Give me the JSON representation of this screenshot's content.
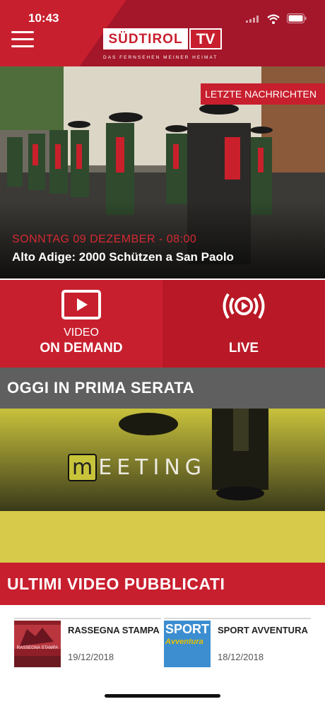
{
  "status_bar": {
    "time": "10:43"
  },
  "header": {
    "logo_main": "SÜDTIROL",
    "logo_tv": "TV",
    "tagline": "DAS FERNSEHEN MEINER HEIMAT"
  },
  "hero": {
    "badge": "LETZTE NACHRICHTEN",
    "date": "SONNTAG 09 DEZEMBER - 08:00",
    "title": "Alto Adige: 2000 Schützen a San Paolo"
  },
  "tiles": {
    "vod": {
      "line1": "VIDEO",
      "line2": "ON DEMAND"
    },
    "live": {
      "line2": "LIVE"
    }
  },
  "prime_time": {
    "heading": "OGGI IN PRIMA SERATA",
    "show_logo_first": "m",
    "show_logo_rest": "EETING"
  },
  "latest": {
    "heading": "ULTIMI VIDEO PUBBLICATI",
    "items": [
      {
        "name": "RASSEGNA STAMPA",
        "date": "19/12/2018",
        "thumb_text": "RASSEGNA STAMPA"
      },
      {
        "name": "SPORT AVVENTURA",
        "date": "18/12/2018",
        "thumb_text_1": "SPORT",
        "thumb_text_2": "Avventura"
      }
    ]
  },
  "colors": {
    "brand_red": "#c81f2e",
    "dark_red": "#a4162a",
    "section_gray": "#5f5f5f",
    "yellow": "#d7c94a"
  }
}
